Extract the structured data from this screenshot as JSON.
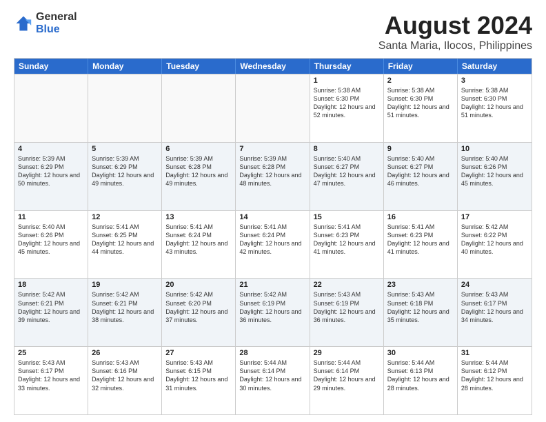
{
  "logo": {
    "general": "General",
    "blue": "Blue"
  },
  "title": "August 2024",
  "subtitle": "Santa Maria, Ilocos, Philippines",
  "header_days": [
    "Sunday",
    "Monday",
    "Tuesday",
    "Wednesday",
    "Thursday",
    "Friday",
    "Saturday"
  ],
  "rows": [
    [
      {
        "day": "",
        "empty": true
      },
      {
        "day": "",
        "empty": true
      },
      {
        "day": "",
        "empty": true
      },
      {
        "day": "",
        "empty": true
      },
      {
        "day": "1",
        "rise": "5:38 AM",
        "set": "6:30 PM",
        "daylight": "12 hours and 52 minutes."
      },
      {
        "day": "2",
        "rise": "5:38 AM",
        "set": "6:30 PM",
        "daylight": "12 hours and 51 minutes."
      },
      {
        "day": "3",
        "rise": "5:38 AM",
        "set": "6:30 PM",
        "daylight": "12 hours and 51 minutes."
      }
    ],
    [
      {
        "day": "4",
        "rise": "5:39 AM",
        "set": "6:29 PM",
        "daylight": "12 hours and 50 minutes."
      },
      {
        "day": "5",
        "rise": "5:39 AM",
        "set": "6:29 PM",
        "daylight": "12 hours and 49 minutes."
      },
      {
        "day": "6",
        "rise": "5:39 AM",
        "set": "6:28 PM",
        "daylight": "12 hours and 49 minutes."
      },
      {
        "day": "7",
        "rise": "5:39 AM",
        "set": "6:28 PM",
        "daylight": "12 hours and 48 minutes."
      },
      {
        "day": "8",
        "rise": "5:40 AM",
        "set": "6:27 PM",
        "daylight": "12 hours and 47 minutes."
      },
      {
        "day": "9",
        "rise": "5:40 AM",
        "set": "6:27 PM",
        "daylight": "12 hours and 46 minutes."
      },
      {
        "day": "10",
        "rise": "5:40 AM",
        "set": "6:26 PM",
        "daylight": "12 hours and 45 minutes."
      }
    ],
    [
      {
        "day": "11",
        "rise": "5:40 AM",
        "set": "6:26 PM",
        "daylight": "12 hours and 45 minutes."
      },
      {
        "day": "12",
        "rise": "5:41 AM",
        "set": "6:25 PM",
        "daylight": "12 hours and 44 minutes."
      },
      {
        "day": "13",
        "rise": "5:41 AM",
        "set": "6:24 PM",
        "daylight": "12 hours and 43 minutes."
      },
      {
        "day": "14",
        "rise": "5:41 AM",
        "set": "6:24 PM",
        "daylight": "12 hours and 42 minutes."
      },
      {
        "day": "15",
        "rise": "5:41 AM",
        "set": "6:23 PM",
        "daylight": "12 hours and 41 minutes."
      },
      {
        "day": "16",
        "rise": "5:41 AM",
        "set": "6:23 PM",
        "daylight": "12 hours and 41 minutes."
      },
      {
        "day": "17",
        "rise": "5:42 AM",
        "set": "6:22 PM",
        "daylight": "12 hours and 40 minutes."
      }
    ],
    [
      {
        "day": "18",
        "rise": "5:42 AM",
        "set": "6:21 PM",
        "daylight": "12 hours and 39 minutes."
      },
      {
        "day": "19",
        "rise": "5:42 AM",
        "set": "6:21 PM",
        "daylight": "12 hours and 38 minutes."
      },
      {
        "day": "20",
        "rise": "5:42 AM",
        "set": "6:20 PM",
        "daylight": "12 hours and 37 minutes."
      },
      {
        "day": "21",
        "rise": "5:42 AM",
        "set": "6:19 PM",
        "daylight": "12 hours and 36 minutes."
      },
      {
        "day": "22",
        "rise": "5:43 AM",
        "set": "6:19 PM",
        "daylight": "12 hours and 36 minutes."
      },
      {
        "day": "23",
        "rise": "5:43 AM",
        "set": "6:18 PM",
        "daylight": "12 hours and 35 minutes."
      },
      {
        "day": "24",
        "rise": "5:43 AM",
        "set": "6:17 PM",
        "daylight": "12 hours and 34 minutes."
      }
    ],
    [
      {
        "day": "25",
        "rise": "5:43 AM",
        "set": "6:17 PM",
        "daylight": "12 hours and 33 minutes."
      },
      {
        "day": "26",
        "rise": "5:43 AM",
        "set": "6:16 PM",
        "daylight": "12 hours and 32 minutes."
      },
      {
        "day": "27",
        "rise": "5:43 AM",
        "set": "6:15 PM",
        "daylight": "12 hours and 31 minutes."
      },
      {
        "day": "28",
        "rise": "5:44 AM",
        "set": "6:14 PM",
        "daylight": "12 hours and 30 minutes."
      },
      {
        "day": "29",
        "rise": "5:44 AM",
        "set": "6:14 PM",
        "daylight": "12 hours and 29 minutes."
      },
      {
        "day": "30",
        "rise": "5:44 AM",
        "set": "6:13 PM",
        "daylight": "12 hours and 28 minutes."
      },
      {
        "day": "31",
        "rise": "5:44 AM",
        "set": "6:12 PM",
        "daylight": "12 hours and 28 minutes."
      }
    ]
  ]
}
